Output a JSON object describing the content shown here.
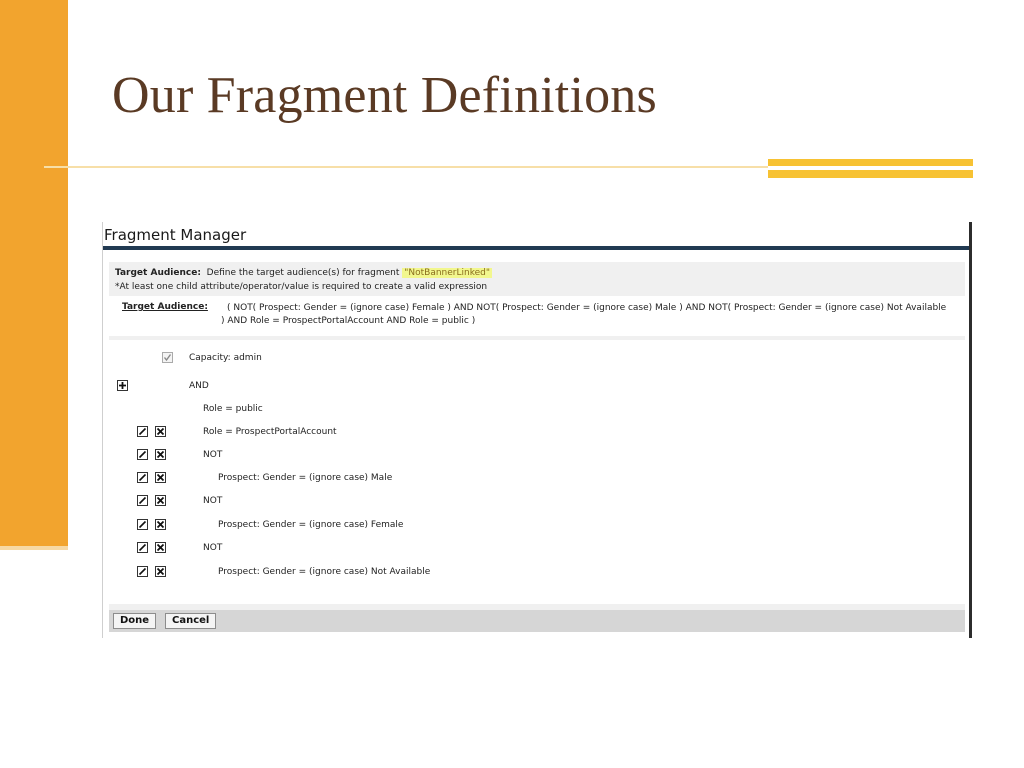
{
  "slide": {
    "title": "Our Fragment Definitions"
  },
  "panel": {
    "title": "Fragment Manager",
    "header_label": "Target Audience:",
    "header_text": "Define the target audience(s) for fragment",
    "fragment_name": "\"NotBannerLinked\"",
    "note": "*At least one child attribute/operator/value is required to create a valid expression",
    "expression_label": "Target Audience:",
    "expression": "( NOT( Prospect: Gender = (ignore case) Female ) AND NOT( Prospect: Gender = (ignore case) Male ) AND NOT( Prospect: Gender = (ignore case) Not Available ) AND Role = ProspectPortalAccount AND Role = public )"
  },
  "tree": {
    "capacity": "Capacity: admin",
    "and_label": "AND",
    "rows": [
      "Role = public",
      "Role = ProspectPortalAccount",
      "NOT",
      "Prospect: Gender = (ignore case) Male",
      "NOT",
      "Prospect: Gender = (ignore case) Female",
      "NOT",
      "Prospect: Gender = (ignore case) Not Available"
    ]
  },
  "buttons": {
    "done": "Done",
    "cancel": "Cancel"
  },
  "icons": {
    "add": "plus-icon",
    "edit": "pencil-icon",
    "delete": "close-icon",
    "capacity": "checkbox-icon"
  },
  "colors": {
    "orange_bar": "#f2a42e",
    "title_text": "#5a3a24",
    "accent": "#f7c233",
    "header_rule": "#213a52",
    "highlight": "#f2f78e"
  }
}
